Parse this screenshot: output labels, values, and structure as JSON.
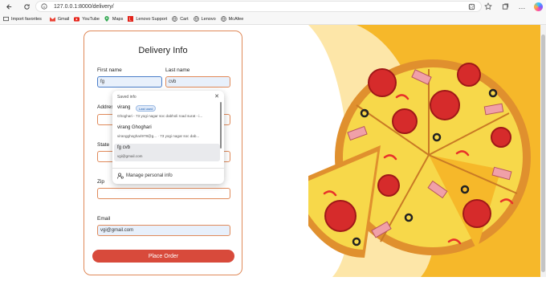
{
  "browser": {
    "url": "127.0.0.1:8000/delivery/",
    "bookmarks": [
      {
        "label": "Import favorites",
        "icon": "import-icon"
      },
      {
        "label": "Gmail",
        "icon": "gmail-icon"
      },
      {
        "label": "YouTube",
        "icon": "youtube-icon"
      },
      {
        "label": "Maps",
        "icon": "maps-icon"
      },
      {
        "label": "Lenovo Support",
        "icon": "lenovo-icon"
      },
      {
        "label": "Cart",
        "icon": "globe-icon"
      },
      {
        "label": "Lenovo",
        "icon": "globe-icon"
      },
      {
        "label": "McAfee",
        "icon": "globe-icon"
      }
    ]
  },
  "form": {
    "title": "Delivery Info",
    "first_name_label": "First name",
    "first_name_value": "fg",
    "last_name_label": "Last name",
    "last_name_value": "cvb",
    "address_label": "Address",
    "state_label": "State",
    "zip_label": "Zip",
    "email_label": "Email",
    "email_value": "vgi@gmail.com",
    "submit_label": "Place Order"
  },
  "autofill": {
    "header": "Saved info",
    "entries": [
      {
        "name": "virang",
        "badge": "Last used",
        "detail": "Ghoghari - 73 yogi nagar soc dabholi road surat - i..."
      },
      {
        "name": "virang Ghoghari",
        "badge": "",
        "detail": "virangghoghari978@g... · 73 yogi nagar soc dab..."
      },
      {
        "name": "fg cvb",
        "badge": "",
        "detail": "vgi@gmail.com"
      }
    ],
    "manage_label": "Manage personal info"
  },
  "colors": {
    "accent": "#d84a3b",
    "field_border": "#e08a5a",
    "pizza_background": "#f6b82a"
  }
}
